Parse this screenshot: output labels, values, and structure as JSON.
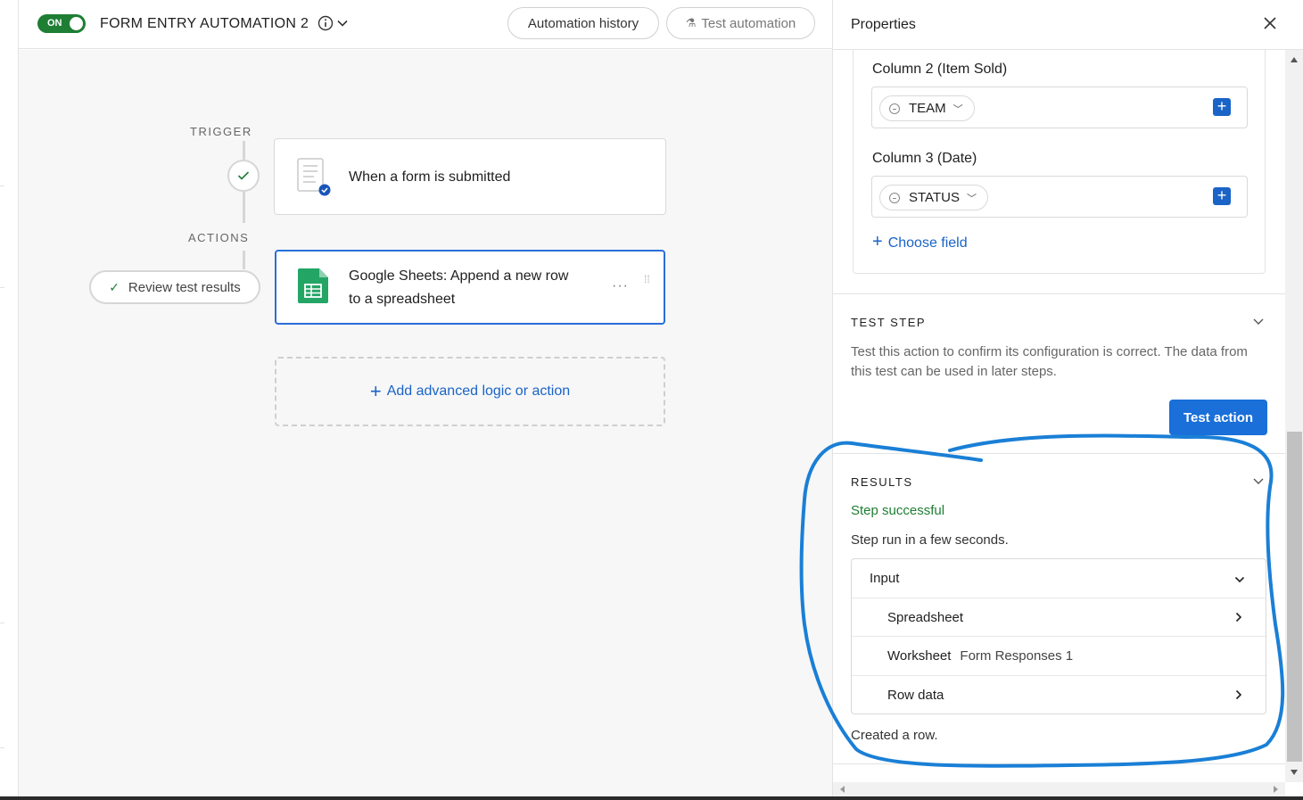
{
  "topbar": {
    "toggle_label": "ON",
    "automation_title": "FORM ENTRY AUTOMATION 2",
    "history_button": "Automation history",
    "test_button": "Test automation"
  },
  "canvas": {
    "trigger_label": "TRIGGER",
    "actions_label": "ACTIONS",
    "trigger_card": {
      "text": "When a form is submitted"
    },
    "action_card": {
      "line1": "Google Sheets: Append a new row",
      "line2": "to a spreadsheet",
      "more": "···"
    },
    "review_button": "Review test results",
    "add_logic": "Add advanced logic or action"
  },
  "panel": {
    "title": "Properties",
    "fields": [
      {
        "label": "Column 2 (Item Sold)",
        "value": "TEAM"
      },
      {
        "label": "Column 3 (Date)",
        "value": "STATUS"
      }
    ],
    "choose_field": "Choose field",
    "test_step": {
      "heading": "TEST STEP",
      "description": "Test this action to confirm its configuration is correct. The data from this test can be used in later steps.",
      "button": "Test action"
    },
    "results": {
      "heading": "RESULTS",
      "status": "Step successful",
      "run_info": "Step run in a few seconds.",
      "input_label": "Input",
      "rows": [
        {
          "label": "Spreadsheet",
          "value": ""
        },
        {
          "label": "Worksheet",
          "value": "Form Responses 1"
        },
        {
          "label": "Row data",
          "value": ""
        }
      ],
      "footer": "Created a row."
    }
  },
  "colors": {
    "accent_blue": "#1a63c7",
    "success_green": "#1e7e34",
    "annotation_blue": "#1a7fd6"
  }
}
